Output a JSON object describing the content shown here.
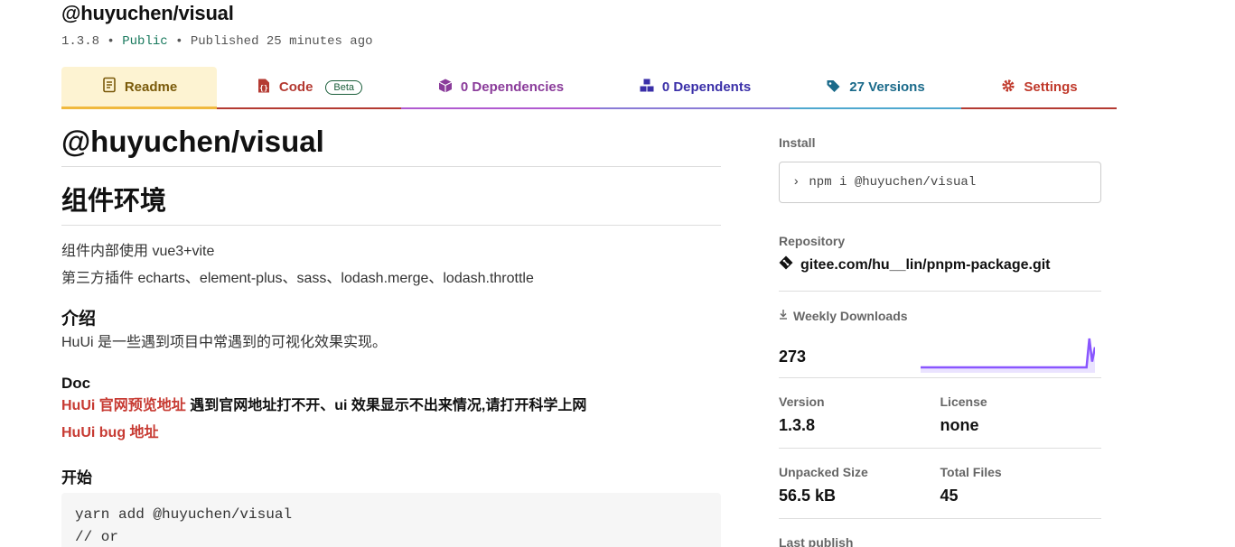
{
  "package": {
    "name": "@huyuchen/visual",
    "version": "1.3.8",
    "sep1": "•",
    "visibility": "Public",
    "sep2": "•",
    "published": "Published 25 minutes ago"
  },
  "tabs": {
    "readme": "Readme",
    "code": "Code",
    "code_badge": "Beta",
    "dependencies": "0 Dependencies",
    "dependents": "0 Dependents",
    "versions": "27 Versions",
    "settings": "Settings"
  },
  "readme": {
    "h1": "@huyuchen/visual",
    "h2": "组件环境",
    "env_line1": "组件内部使用 vue3+vite",
    "env_line2": "第三方插件 echarts、element-plus、sass、lodash.merge、lodash.throttle",
    "intro_heading": "介绍",
    "intro_text": "HuUi 是一些遇到项目中常遇到的可视化效果实现。",
    "doc_heading": "Doc",
    "doc_link1": "HuUi 官网预览地址",
    "doc_note": " 遇到官网地址打不开、ui 效果显示不出来情况,请打开科学上网",
    "doc_link2_a": "HuUi bug ",
    "doc_link2_b": "地址",
    "start_heading": "开始",
    "code_line1": "yarn add @huyuchen/visual",
    "code_line2": "// or"
  },
  "sidebar": {
    "install_label": "Install",
    "install_prompt": "›",
    "install_cmd": "npm i @huyuchen/visual",
    "repo_label": "Repository",
    "repo_url": "gitee.com/hu__lin/pnpm-package.git",
    "downloads_label": "Weekly Downloads",
    "downloads_count": "273",
    "downloads_spark": [
      0,
      0,
      0,
      0,
      0,
      0,
      0,
      0,
      0,
      0,
      0,
      0,
      0,
      0,
      0,
      0,
      0,
      0,
      0,
      0,
      0,
      0,
      0,
      0,
      0,
      0,
      0,
      0,
      0,
      0,
      0,
      0,
      0,
      0,
      0,
      0,
      0,
      0,
      0,
      0,
      0,
      0,
      0,
      0,
      0,
      0,
      0,
      0,
      0,
      0,
      0,
      0,
      0,
      0,
      0,
      0,
      0,
      0,
      0,
      0,
      1,
      0.2,
      0.7
    ],
    "version_label": "Version",
    "version_value": "1.3.8",
    "license_label": "License",
    "license_value": "none",
    "size_label": "Unpacked Size",
    "size_value": "56.5 kB",
    "files_label": "Total Files",
    "files_value": "45",
    "last_publish_label": "Last publish"
  },
  "colors": {
    "readme_tab_bg": "#fdf3d2",
    "code_accent": "#b43a32",
    "deps_accent": "#8a3b9a",
    "dependents_accent": "#3a2fa8",
    "versions_accent": "#1a6a8a",
    "settings_accent": "#c0392b",
    "spark_line": "#8956ff",
    "spark_fill": "#eae3ff"
  }
}
